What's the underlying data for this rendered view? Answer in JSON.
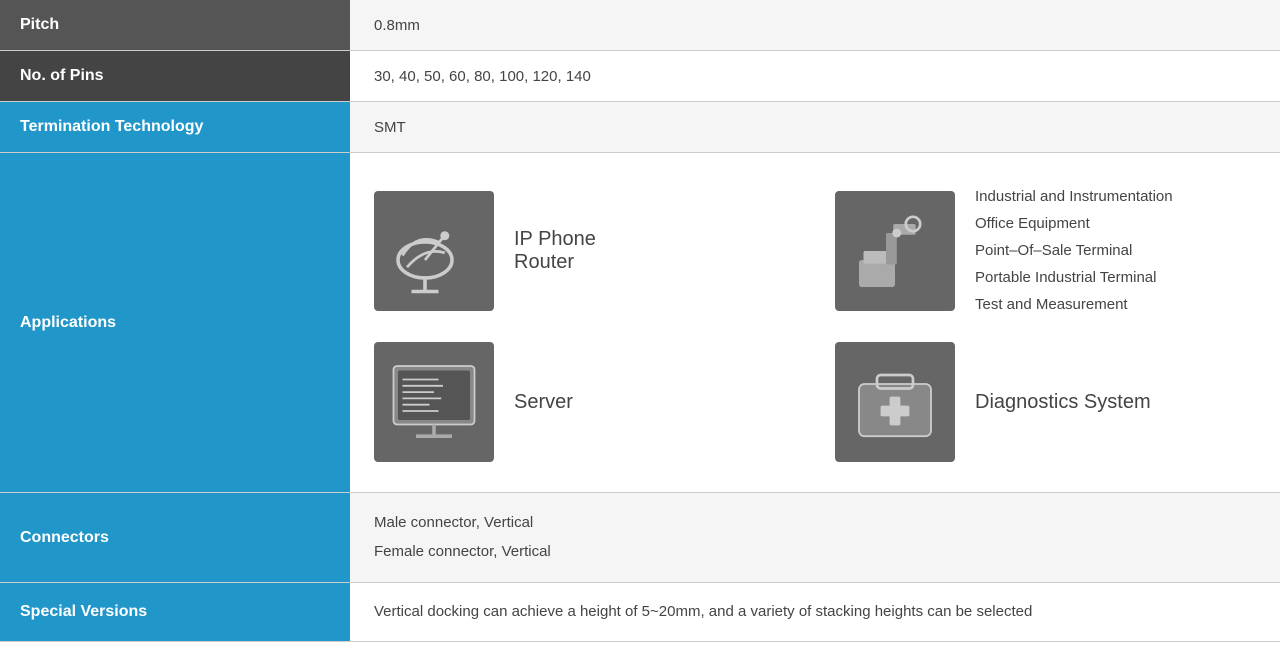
{
  "rows": {
    "pitch": {
      "label": "Pitch",
      "value": "0.8mm"
    },
    "pins": {
      "label": "No. of Pins",
      "value": "30, 40, 50, 60, 80, 100, 120, 140"
    },
    "termination": {
      "label": "Termination Technology",
      "value": "SMT"
    },
    "applications": {
      "label": "Applications",
      "items": [
        {
          "icon": "satellite-dish",
          "label": "IP Phone\nRouter"
        },
        {
          "icon": "industrial",
          "lines": [
            "Industrial and Instrumentation",
            "Office Equipment",
            "Point–Of–Sale Terminal",
            "Portable Industrial Terminal",
            "Test and Measurement"
          ]
        },
        {
          "icon": "server",
          "label": "Server"
        },
        {
          "icon": "diagnostics",
          "label": "Diagnostics System"
        }
      ]
    },
    "connectors": {
      "label": "Connectors",
      "line1": "Male connector, Vertical",
      "line2": "Female connector, Vertical"
    },
    "special": {
      "label": "Special Versions",
      "value": "Vertical docking can achieve a height of 5~20mm, and a variety of stacking heights can be selected"
    }
  }
}
